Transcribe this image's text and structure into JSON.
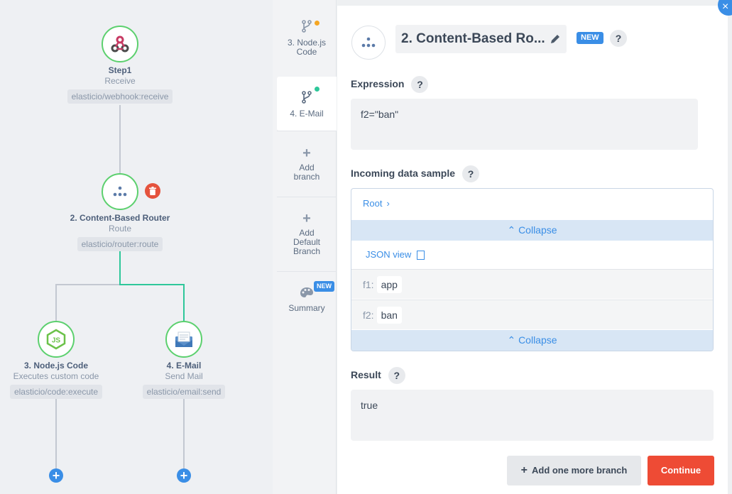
{
  "flow": {
    "step1": {
      "title": "Step1",
      "subtitle": "Receive",
      "tag": "elasticio/webhook:receive",
      "icon": "webhook-icon"
    },
    "router": {
      "title": "2. Content-Based Router",
      "subtitle": "Route",
      "tag": "elasticio/router:route",
      "icon": "router-icon"
    },
    "node_js": {
      "title": "3. Node.js Code",
      "subtitle": "Executes custom code",
      "tag": "elasticio/code:execute",
      "icon": "nodejs-icon"
    },
    "email": {
      "title": "4. E-Mail",
      "subtitle": "Send Mail",
      "tag": "elasticio/email:send",
      "icon": "email-icon"
    },
    "plus": "+"
  },
  "tabs": {
    "node_js": "3. Node.js Code",
    "email": "4. E-Mail",
    "add_branch": "Add branch",
    "add_default": "Add Default Branch",
    "summary": "Summary",
    "summary_badge": "NEW",
    "plus": "+"
  },
  "panel": {
    "title": "2. Content-Based Ro...",
    "badge": "NEW",
    "qmark": "?",
    "expression_label": "Expression",
    "expression_value": "f2=\"ban\"",
    "incoming_label": "Incoming data sample",
    "breadcrumb": "Root",
    "collapse": "Collapse",
    "json_view": "JSON view",
    "fields": [
      {
        "key": "f1:",
        "value": "app"
      },
      {
        "key": "f2:",
        "value": "ban"
      }
    ],
    "result_label": "Result",
    "result_value": "true",
    "add_branch_button": "Add one more branch",
    "continue_button": "Continue",
    "close": "×"
  },
  "colors": {
    "accent": "#3a8ee6",
    "green": "#2ec79a",
    "danger": "#ee4b35",
    "node_border": "#5cd06e"
  }
}
